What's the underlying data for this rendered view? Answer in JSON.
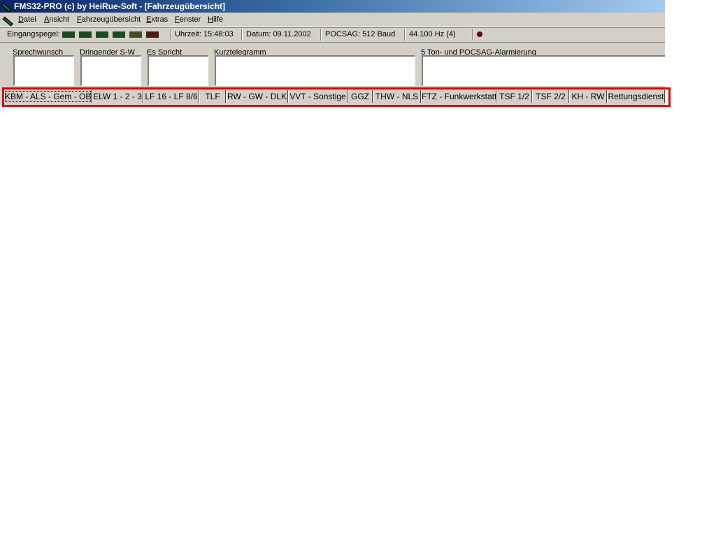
{
  "window": {
    "title": "FMS32-PRO (c) by HeiRue-Soft - [Fahrzeugübersicht]"
  },
  "menu": [
    "Datei",
    "Ansicht",
    "Fahrzeugübersicht",
    "Extras",
    "Fenster",
    "Hilfe"
  ],
  "status": {
    "eingangspegel_label": "Eingangspegel:",
    "uhrzeit": "Uhrzeit: 15:48:03",
    "datum": "Datum:  09.11.2002",
    "pocsag": "POCSAG: 512 Baud",
    "hz": "44.100 Hz (4)",
    "led_colors": [
      "#1f4a1f",
      "#1f4a1f",
      "#1f4a1f",
      "#1f4a1f",
      "#4a4a24",
      "#4a1a14"
    ],
    "indicator_color": "#5a0a0a"
  },
  "panels": [
    "Sprechwunsch",
    "Dringender S-W",
    "Es Spricht",
    "Kurztelegramm",
    "5 Ton- und POCSAG-Alarmierung"
  ],
  "tabs": [
    "KBM - ALS - Gem - OBM",
    "ELW 1 - 2 - 3",
    "LF 16 - LF 8/6",
    "TLF",
    "RW - GW - DLK",
    "VVT - Sonstige",
    "GGZ",
    "THW - NLS",
    "FTZ - Funkwerkstatt",
    "TSF 1/2",
    "TSF 2/2",
    "KH - RW",
    "Rettungsdienst"
  ],
  "active_tab": 0
}
